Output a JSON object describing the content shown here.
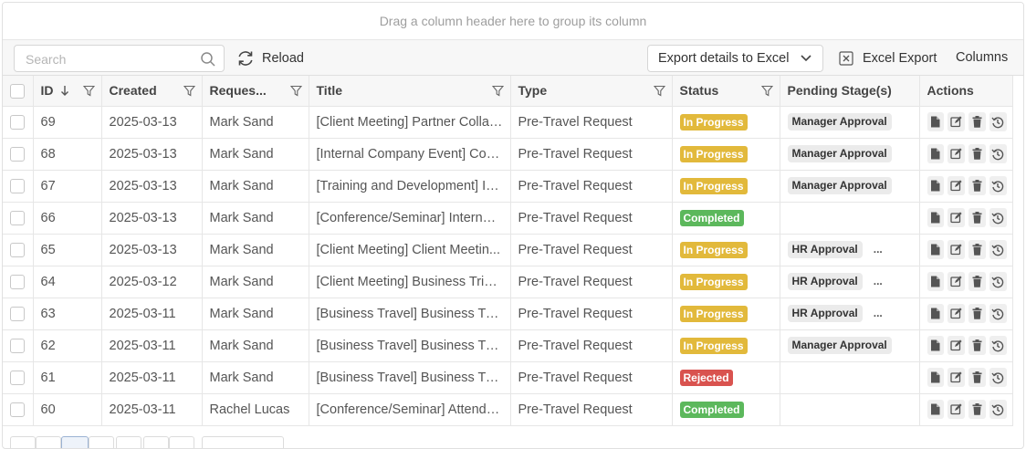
{
  "group_panel": {
    "text": "Drag a column header here to group its column"
  },
  "toolbar": {
    "search_placeholder": "Search",
    "reload_label": "Reload",
    "export_details_label": "Export details to Excel",
    "excel_export_label": "Excel Export",
    "columns_label": "Columns"
  },
  "columns": [
    "ID",
    "Created",
    "Reques...",
    "Title",
    "Type",
    "Status",
    "Pending Stage(s)",
    "Actions"
  ],
  "status_colors": {
    "In Progress": "#e2b93b",
    "Completed": "#5cb85c",
    "Rejected": "#d9534f"
  },
  "rows": [
    {
      "id": "69",
      "created": "2025-03-13",
      "requester": "Mark Sand",
      "title": "[Client Meeting] Partner Collab...",
      "type": "Pre-Travel Request",
      "status": "In Progress",
      "stage": "Manager Approval",
      "more": ""
    },
    {
      "id": "68",
      "created": "2025-03-13",
      "requester": "Mark Sand",
      "title": "[Internal Company Event] Corp...",
      "type": "Pre-Travel Request",
      "status": "In Progress",
      "stage": "Manager Approval",
      "more": ""
    },
    {
      "id": "67",
      "created": "2025-03-13",
      "requester": "Mark Sand",
      "title": "[Training and Development] In...",
      "type": "Pre-Travel Request",
      "status": "In Progress",
      "stage": "Manager Approval",
      "more": ""
    },
    {
      "id": "66",
      "created": "2025-03-13",
      "requester": "Mark Sand",
      "title": "[Conference/Seminar] Internati...",
      "type": "Pre-Travel Request",
      "status": "Completed",
      "stage": "",
      "more": ""
    },
    {
      "id": "65",
      "created": "2025-03-13",
      "requester": "Mark Sand",
      "title": "[Client Meeting] Client Meetin...",
      "type": "Pre-Travel Request",
      "status": "In Progress",
      "stage": "HR Approval",
      "more": "..."
    },
    {
      "id": "64",
      "created": "2025-03-12",
      "requester": "Mark Sand",
      "title": "[Client Meeting] Business Trip ...",
      "type": "Pre-Travel Request",
      "status": "In Progress",
      "stage": "HR Approval",
      "more": "..."
    },
    {
      "id": "63",
      "created": "2025-03-11",
      "requester": "Mark Sand",
      "title": "[Business Travel] Business Trip...",
      "type": "Pre-Travel Request",
      "status": "In Progress",
      "stage": "HR Approval",
      "more": "..."
    },
    {
      "id": "62",
      "created": "2025-03-11",
      "requester": "Mark Sand",
      "title": "[Business Travel] Business Tra...",
      "type": "Pre-Travel Request",
      "status": "In Progress",
      "stage": "Manager Approval",
      "more": ""
    },
    {
      "id": "61",
      "created": "2025-03-11",
      "requester": "Mark Sand",
      "title": "[Business Travel] Business Tra...",
      "type": "Pre-Travel Request",
      "status": "Rejected",
      "stage": "",
      "more": ""
    },
    {
      "id": "60",
      "created": "2025-03-11",
      "requester": "Rachel Lucas",
      "title": "[Conference/Seminar] Attend tr...",
      "type": "Pre-Travel Request",
      "status": "Completed",
      "stage": "",
      "more": ""
    }
  ],
  "icons": {
    "search": "search-icon",
    "reload": "reload-icon",
    "chevron": "chevron-down-icon",
    "excel": "excel-icon",
    "filter": "filter-icon",
    "sort": "sort-down-icon",
    "actions": [
      "view-icon",
      "edit-icon",
      "delete-icon",
      "history-icon"
    ]
  }
}
